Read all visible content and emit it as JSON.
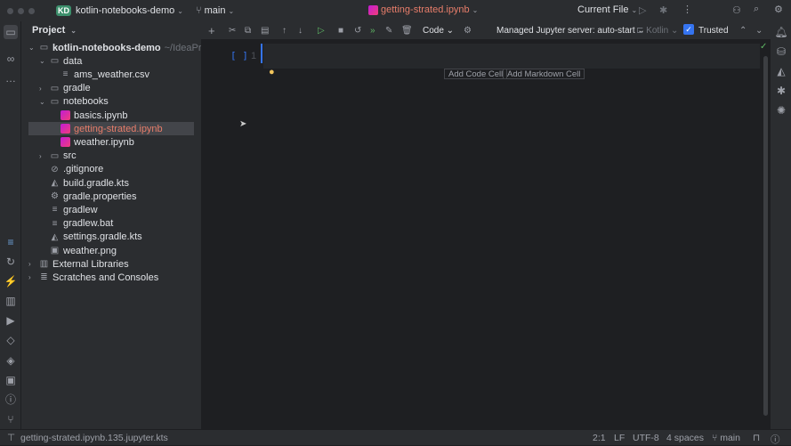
{
  "titlebar": {
    "project_badge": "KD",
    "project": "kotlin-notebooks-demo",
    "branch": "main",
    "file": "getting-strated.ipynb",
    "run_config": "Current File"
  },
  "panel": {
    "title": "Project"
  },
  "tree": [
    {
      "label": "kotlin-notebooks-demo",
      "suffix": "~/IdeaProje",
      "depth": 0,
      "arrow": "⌄",
      "icon": "folder-module-icon",
      "bold": true
    },
    {
      "label": "data",
      "depth": 1,
      "arrow": "⌄",
      "icon": "folder-icon"
    },
    {
      "label": "ams_weather.csv",
      "depth": 2,
      "arrow": "",
      "icon": "csv-file-icon"
    },
    {
      "label": "gradle",
      "depth": 1,
      "arrow": "›",
      "icon": "folder-icon"
    },
    {
      "label": "notebooks",
      "depth": 1,
      "arrow": "⌄",
      "icon": "folder-icon"
    },
    {
      "label": "basics.ipynb",
      "depth": 2,
      "arrow": "",
      "icon": "notebook-icon"
    },
    {
      "label": "getting-strated.ipynb",
      "depth": 2,
      "arrow": "",
      "icon": "notebook-icon",
      "selected": true
    },
    {
      "label": "weather.ipynb",
      "depth": 2,
      "arrow": "",
      "icon": "notebook-icon"
    },
    {
      "label": "src",
      "depth": 1,
      "arrow": "›",
      "icon": "folder-icon"
    },
    {
      "label": ".gitignore",
      "depth": 1,
      "arrow": "",
      "icon": "ignore-file-icon"
    },
    {
      "label": "build.gradle.kts",
      "depth": 1,
      "arrow": "",
      "icon": "gradle-icon"
    },
    {
      "label": "gradle.properties",
      "depth": 1,
      "arrow": "",
      "icon": "settings-file-icon"
    },
    {
      "label": "gradlew",
      "depth": 1,
      "arrow": "",
      "icon": "text-file-icon"
    },
    {
      "label": "gradlew.bat",
      "depth": 1,
      "arrow": "",
      "icon": "text-file-icon"
    },
    {
      "label": "settings.gradle.kts",
      "depth": 1,
      "arrow": "",
      "icon": "gradle-icon"
    },
    {
      "label": "weather.png",
      "depth": 1,
      "arrow": "",
      "icon": "image-file-icon"
    },
    {
      "label": "External Libraries",
      "depth": 0,
      "arrow": "›",
      "icon": "library-icon"
    },
    {
      "label": "Scratches and Consoles",
      "depth": 0,
      "arrow": "›",
      "icon": "scratches-icon"
    }
  ],
  "editor": {
    "cell_type": "Code",
    "server": "Managed Jupyter server: auto-start",
    "kernel": "Kotlin",
    "trusted_label": "Trusted",
    "trusted": true,
    "exec_marker": "[ ]",
    "line_number": "1",
    "add_code": "Add Code Cell",
    "add_markdown": "Add Markdown Cell"
  },
  "status": {
    "file": "getting-strated.ipynb.135.jupyter.kts",
    "position": "2:1",
    "line_sep": "LF",
    "encoding": "UTF-8",
    "indent": "4 spaces",
    "branch": "main"
  },
  "colors": {
    "accent": "#3574f0",
    "selected_file": "#e77d6a",
    "badge": "#3d8f6c"
  }
}
